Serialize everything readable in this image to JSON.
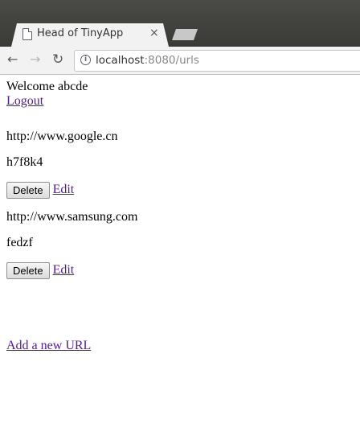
{
  "browser": {
    "tab_title": "Head of TinyApp",
    "tab_close_glyph": "×",
    "url_host": "localhost",
    "url_rest": ":8080/urls"
  },
  "icons": {
    "back": "arrow-left-icon",
    "forward": "arrow-right-icon",
    "reload": "reload-icon",
    "info": "info-icon",
    "page": "page-icon"
  },
  "header": {
    "welcome": "Welcome abcde",
    "logout": "Logout"
  },
  "urls": [
    {
      "long_url": "http://www.google.cn",
      "short_url": "h7f8k4",
      "delete_label": "Delete",
      "edit_label": "Edit"
    },
    {
      "long_url": "http://www.samsung.com",
      "short_url": "fedzf",
      "delete_label": "Delete",
      "edit_label": "Edit"
    }
  ],
  "footer": {
    "add_new": "Add a new URL"
  },
  "colors": {
    "link": "#551a8b",
    "chrome_dark": "#3a3a37",
    "toolbar": "#f2f2f2"
  }
}
